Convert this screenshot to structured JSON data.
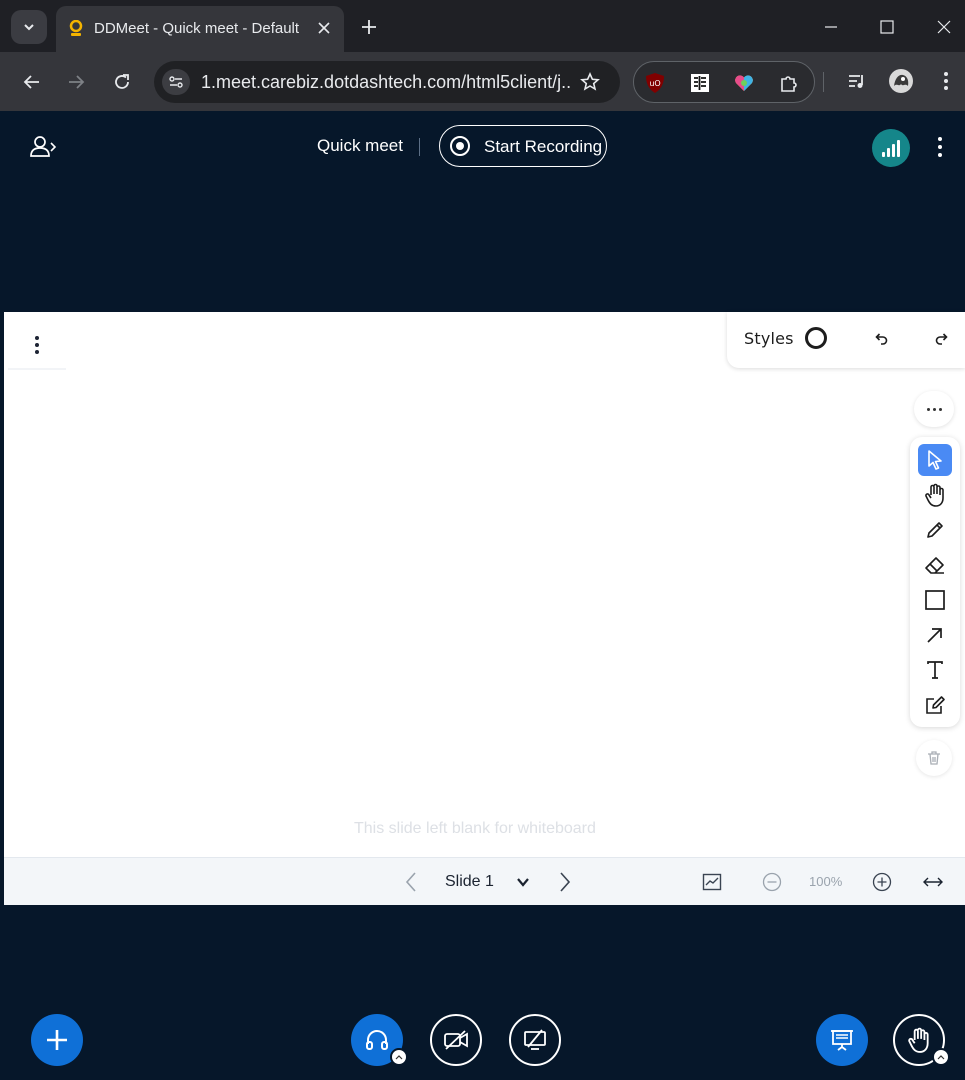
{
  "browser": {
    "tab_title": "DDMeet - Quick meet - Default",
    "url": "1.meet.carebiz.dotdashtech.com/html5client/j...",
    "icons": [
      "tab-search-icon",
      "favicon-icon",
      "close-icon",
      "plus-icon",
      "minimize-icon",
      "maximize-icon",
      "window-close-icon",
      "back-icon",
      "forward-icon",
      "reload-icon",
      "site-info-icon",
      "star-icon",
      "ublock-icon",
      "reader-icon",
      "heart-extension-icon",
      "puzzle-icon",
      "media-icon",
      "profile-avatar-icon",
      "more-vertical-icon"
    ]
  },
  "header": {
    "meeting_title": "Quick meet",
    "record_label": "Start Recording",
    "connection_color": "#15868a"
  },
  "whiteboard": {
    "styles_label": "Styles",
    "blank_text": "This slide left blank for whiteboard",
    "tools": [
      "select",
      "pan",
      "draw",
      "eraser",
      "rectangle",
      "arrow",
      "text",
      "note"
    ],
    "selected_tool": "select",
    "selected_color": "#4a8af4"
  },
  "slide_controls": {
    "slide_label": "Slide 1",
    "zoom": "100%"
  },
  "colors": {
    "app_background": "#06172a",
    "primary": "#0f70d7",
    "browser_tab": "#35363b"
  }
}
